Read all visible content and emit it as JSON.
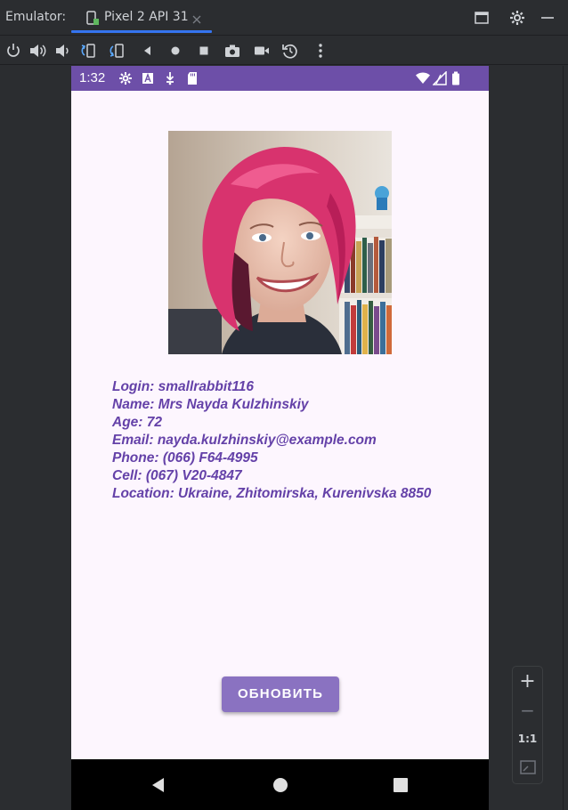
{
  "ide": {
    "label": "Emulator:",
    "tab_title": "Pixel 2 API 31"
  },
  "toolbar": {
    "buttons": [
      "power-icon",
      "volume-up-icon",
      "volume-down-icon",
      "rotate-left-icon",
      "rotate-right-icon",
      "back-icon",
      "home-icon",
      "overview-icon",
      "camera-icon",
      "video-icon",
      "snapshot-icon",
      "more-icon"
    ]
  },
  "phone": {
    "status_time": "1:32",
    "login": "Login: smallrabbit116",
    "name": "Name: Mrs Nayda Kulzhinskiy",
    "age": "Age: 72",
    "email": "Email: nayda.kulzhinskiy@example.com",
    "phone": "Phone: (066) F64-4995",
    "cell": "Cell: (067) V20-4847",
    "location": "Location: Ukraine, Zhitomirska, Kurenivska 8850",
    "refresh_label": "ОБНОВИТЬ"
  },
  "zoom": {
    "plus": "+",
    "minus": "−",
    "one_to_one": "1:1"
  },
  "colors": {
    "status_bar": "#6d4fa8",
    "text_accent": "#6441a8",
    "button": "#8a72c1",
    "phone_bg": "#fdf6fe"
  }
}
